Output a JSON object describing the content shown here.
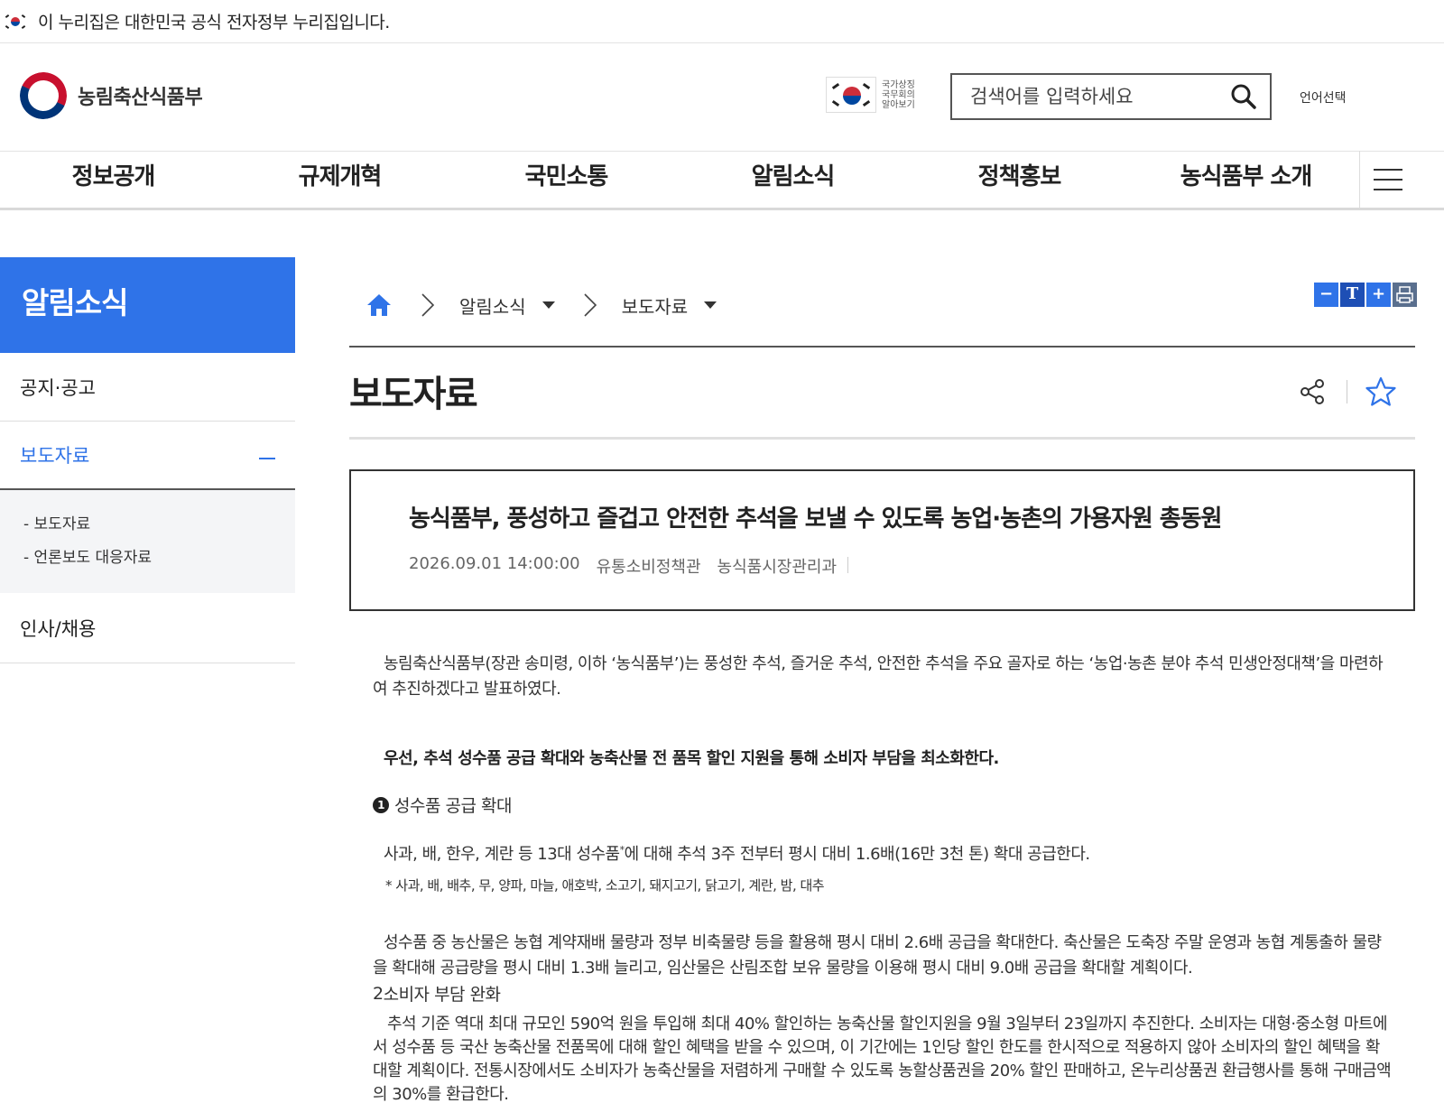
{
  "gov_banner": {
    "text": "이 누리집은 대한민국 공식 전자정부 누리집입니다."
  },
  "header": {
    "logo_text": "농림축산식품부",
    "national_symbol_label": "국가상징 국무회의 알아보기",
    "search_placeholder": "검색어를 입력하세요",
    "language_button": "언어선택"
  },
  "gnb": {
    "items": [
      "정보공개",
      "규제개혁",
      "국민소통",
      "알림소식",
      "정책홍보",
      "농식품부 소개"
    ]
  },
  "lnb": {
    "title": "알림소식",
    "items": [
      {
        "label": "공지·공고"
      },
      {
        "label": "보도자료",
        "active": true
      },
      {
        "label": "인사/채용"
      }
    ],
    "sub_items": [
      "보도자료",
      "언론보도 대응자료"
    ]
  },
  "breadcrumb": {
    "level1": "알림소식",
    "level2": "보도자료"
  },
  "tools": {
    "minus": "−",
    "text": "T",
    "plus": "+"
  },
  "page": {
    "title": "보도자료"
  },
  "article": {
    "headline": "농식품부, 풍성하고 즐겁고 안전한 추석을 보낼 수 있도록 농업·농촌의 가용자원 총동원",
    "date": "2026.09.01 14:00:00",
    "department": "유통소비정책관",
    "division": "농식품시장관리과",
    "intro": "농림축산식품부(장관 송미령, 이하 ‘농식품부’)는 풍성한 추석, 즐거운 추석, 안전한 추석을 주요 골자로 하는 ‘농업·농촌 분야 추석 민생안정대책’을 마련하여 추진하겠다고 발표하였다.",
    "bold_line": "우선, 추석 성수품 공급 확대와 농축산물 전 품목 할인 지원을 통해 소비자 부담을 최소화한다.",
    "section1_num": "1",
    "section1_title": "성수품 공급 확대",
    "section1_text_a": "사과, 배, 한우, 계란 등 13대 성수품",
    "section1_sup": "*",
    "section1_text_b": "에 대해 추석 3주 전부터 평시 대비 1.6배(16만 3천 톤) 확대 공급한다.",
    "section1_note": "* 사과, 배, 배추, 무, 양파, 마늘, 애호박, 소고기, 돼지고기, 닭고기, 계란, 밤, 대추",
    "section1_detail": "성수품 중 농산물은 농협 계약재배 물량과 정부 비축물량 등을 활용해 평시 대비 2.6배 공급을 확대한다. 축산물은 도축장 주말 운영과 농협 계통출하 물량을 확대해 공급량을 평시 대비 1.3배 늘리고, 임산물은 산림조합 보유 물량을 이용해 평시 대비 9.0배 공급을 확대할 계획이다.",
    "section2_num": "2",
    "section2_title": "소비자 부담 완화",
    "section2_text": "추석 기준 역대 최대 규모인 590억 원을 투입해 최대 40% 할인하는 농축산물 할인지원을 9월 3일부터 23일까지 추진한다. 소비자는 대형·중소형 마트에서 성수품 등 국산 농축산물 전품목에 대해 할인 혜택을 받을 수 있으며, 이 기간에는 1인당 할인 한도를 한시적으로 적용하지 않아 소비자의 할인 혜택을 확대할 계획이다. 전통시장에서도 소비자가 농축산물을 저렴하게 구매할 수 있도록 농할상품권을 20% 할인 판매하고, 온누리상품권 환급행사를 통해 구매금액의 30%를 환급한다."
  },
  "colors": {
    "accent": "#2f73e8",
    "text": "#222222"
  }
}
